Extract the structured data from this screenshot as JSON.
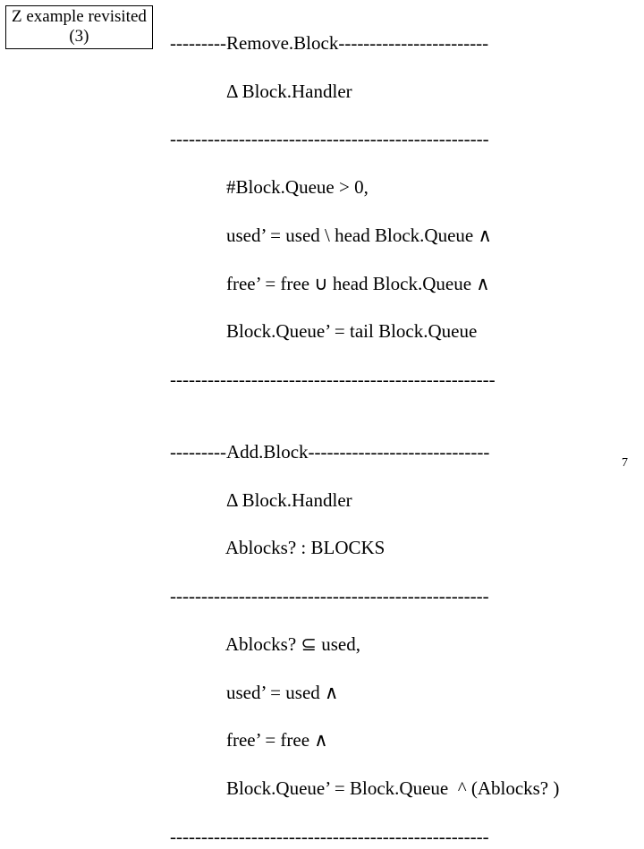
{
  "label": {
    "line1": "Z example revisited",
    "line2": "(3)"
  },
  "remove": {
    "title": "---------Remove.Block------------------------",
    "decl": "            Δ Block.Handler",
    "sep1": "---------------------------------------------------",
    "l1": "            #Block.Queue > 0,",
    "l2": "            used’ = used \\ head Block.Queue ∧",
    "l3": "            free’ = free ∪ head Block.Queue ∧",
    "l4": "            Block.Queue’ = tail Block.Queue",
    "sep2": "----------------------------------------------------"
  },
  "add": {
    "title": "---------Add.Block-----------------------------",
    "decl1": "            Δ Block.Handler",
    "decl2": "            Ablocks? : BLOCKS",
    "sep1": "---------------------------------------------------",
    "l1": "            Ablocks? ⊆ used,",
    "l2": "            used’ = used ∧",
    "l3": "            free’ = free ∧",
    "l4": "            Block.Queue’ = Block.Queue  ^ (Ablocks? )",
    "sep2": "---------------------------------------------------"
  },
  "page": "7"
}
